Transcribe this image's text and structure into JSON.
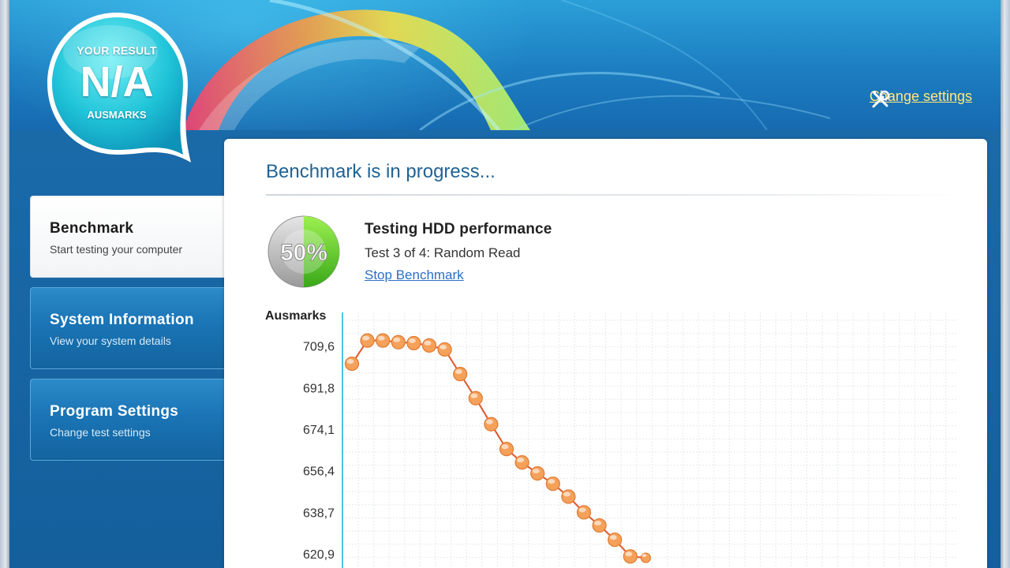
{
  "header": {
    "change_settings_label": "Change settings",
    "tools_icon": "tools-icon"
  },
  "result": {
    "top_label": "YOUR RESULT",
    "value": "N/A",
    "bottom_label": "AUSMARKS"
  },
  "sidebar": {
    "items": [
      {
        "title": "Benchmark",
        "subtitle": "Start testing your computer",
        "active": true
      },
      {
        "title": "System Information",
        "subtitle": "View your system details",
        "active": false
      },
      {
        "title": "Program Settings",
        "subtitle": "Change test settings",
        "active": false
      }
    ]
  },
  "main": {
    "title": "Benchmark is in progress...",
    "progress": {
      "percent": 50,
      "label": "50%"
    },
    "test_name": "Testing HDD performance",
    "test_step": "Test 3 of 4: Random Read",
    "stop_label": "Stop Benchmark"
  },
  "colors": {
    "accent": "#1f6396",
    "link": "#2a6fc6",
    "point_fill": "#f5a15a",
    "line": "#e0562a",
    "axis": "#4cc4e8",
    "progress_green": "#5ec628"
  },
  "chart_data": {
    "type": "line",
    "title": "",
    "xlabel": "",
    "ylabel": "Ausmarks",
    "yticks": [
      "709,6",
      "691,8",
      "674,1",
      "656,4",
      "638,7",
      "620,9"
    ],
    "ylim": [
      606.5,
      724.3
    ],
    "grid": true,
    "x": [
      1,
      2,
      3,
      4,
      5,
      6,
      7,
      8,
      9,
      10,
      11,
      12,
      13,
      14,
      15,
      16,
      17,
      18,
      19,
      20
    ],
    "y": [
      702.4,
      712.3,
      712.3,
      711.6,
      711.2,
      710.2,
      708.5,
      698.0,
      687.7,
      676.6,
      666.0,
      660.3,
      655.6,
      651.2,
      645.7,
      639.0,
      633.4,
      627.3,
      620.2,
      619.6
    ]
  }
}
